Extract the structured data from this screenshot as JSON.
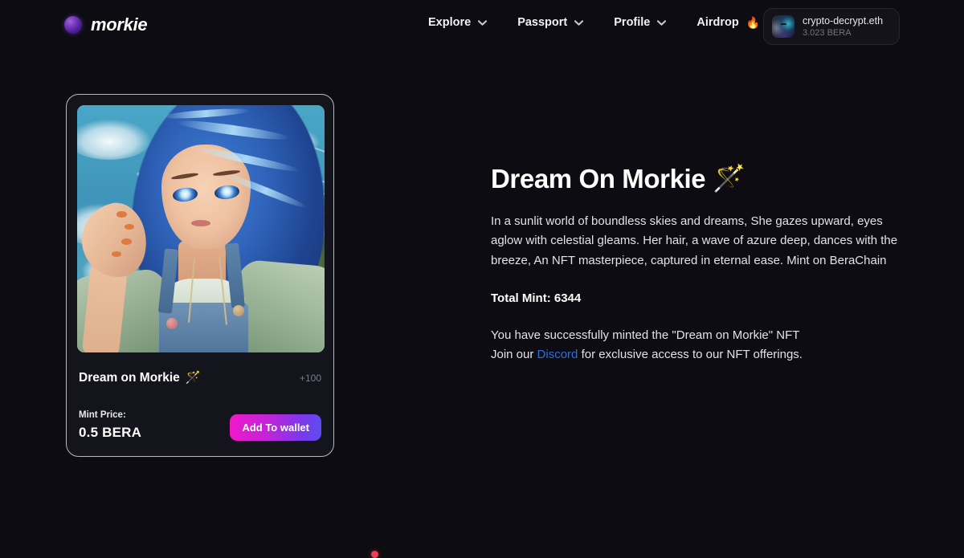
{
  "brand": {
    "name": "morkie",
    "orb_color": "#7a39bd"
  },
  "nav": {
    "items": [
      {
        "label": "Explore",
        "emoji": "",
        "has_chevron": true
      },
      {
        "label": "Passport",
        "emoji": "",
        "has_chevron": true
      },
      {
        "label": "Profile",
        "emoji": "",
        "has_chevron": true
      },
      {
        "label": "Airdrop",
        "emoji": "🔥",
        "has_chevron": true
      }
    ]
  },
  "wallet": {
    "address": "crypto-decrypt.eth",
    "balance": "3.023 BERA"
  },
  "card": {
    "title": "Dream on Morkie",
    "title_emoji": "🪄",
    "badge": "+100",
    "price_label": "Mint Price:",
    "price_value": "0.5 BERA",
    "button_label": "Add To wallet",
    "artwork_alt": "Anime girl with blue hair under a blue sky"
  },
  "detail": {
    "title": "Dream On Morkie",
    "title_emoji": "🪄",
    "description": "In a sunlit world of boundless skies and dreams, She gazes upward, eyes aglow with celestial gleams. Her hair, a wave of azure deep, dances with the breeze, An NFT masterpiece, captured in eternal ease. Mint on BeraChain",
    "total_mint_label": "Total Mint:",
    "total_mint_value": "6344",
    "total_mint_line": "Total Mint: 6344",
    "success_line": "You have successfully minted the \"Dream on Morkie\" NFT",
    "join_prefix": "Join our ",
    "discord_label": "Discord",
    "join_suffix": " for exclusive access to our NFT offerings."
  },
  "colors": {
    "page_background": "#0c0c12",
    "card_background": "#14141c",
    "card_border": "#b9b9c4",
    "accent_gradient_start": "#ef19c9",
    "accent_gradient_end": "#5b4ef0",
    "link_blue": "#2f6fe0",
    "muted_text": "#7b7b86",
    "notification_dot": "#f23b57"
  }
}
